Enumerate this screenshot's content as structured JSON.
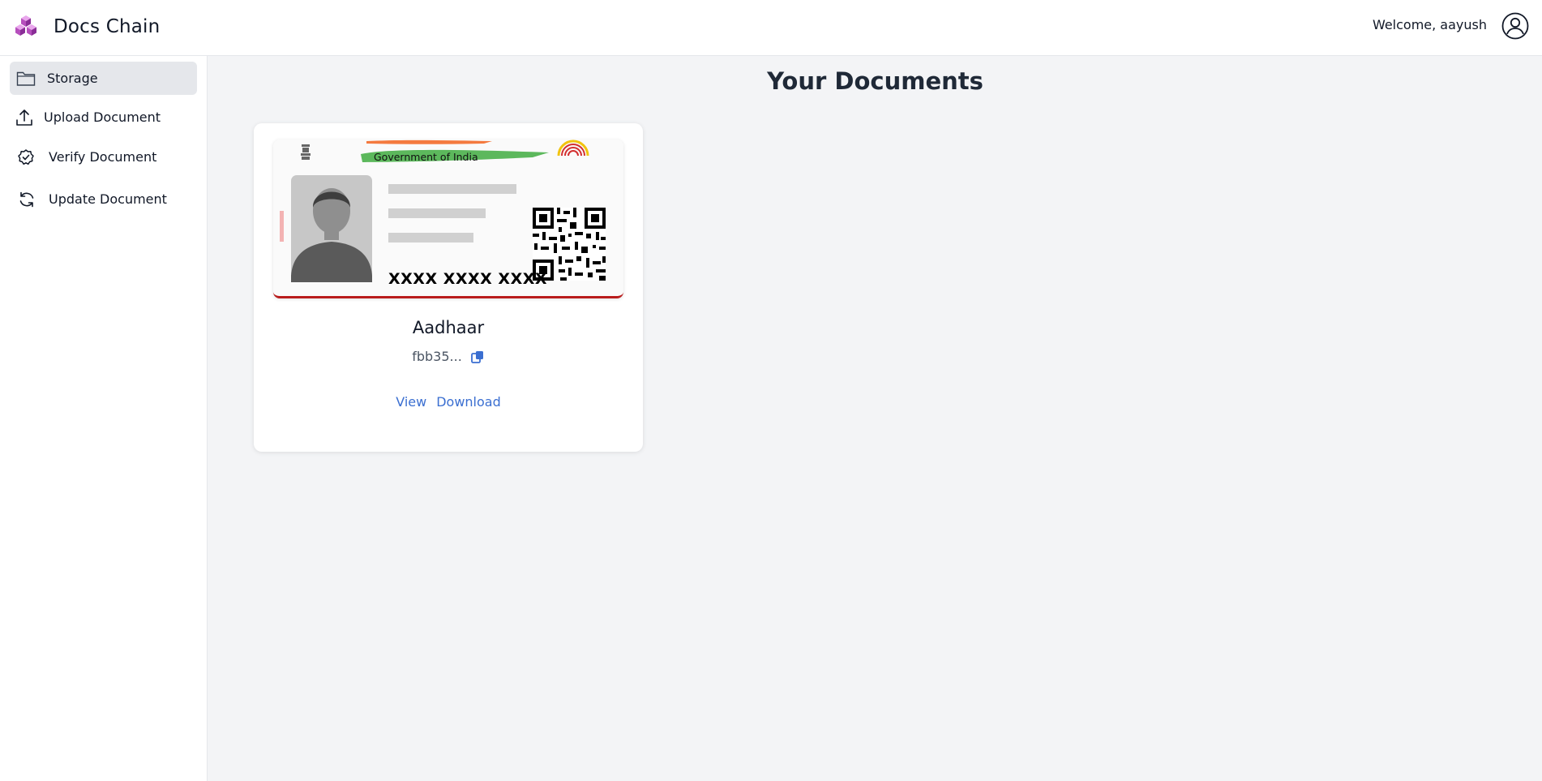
{
  "header": {
    "app_name": "Docs Chain",
    "welcome_text": "Welcome, aayush"
  },
  "sidebar": {
    "items": [
      {
        "label": "Storage",
        "icon": "folder-icon",
        "active": true
      },
      {
        "label": "Upload Document",
        "icon": "upload-icon",
        "active": false
      },
      {
        "label": "Verify Document",
        "icon": "verify-badge-icon",
        "active": false
      },
      {
        "label": "Update Document",
        "icon": "refresh-icon",
        "active": false
      }
    ]
  },
  "main": {
    "title": "Your Documents",
    "documents": [
      {
        "name": "Aadhaar",
        "hash_short": "fbb35...",
        "thumbnail": {
          "header_text": "Government of India",
          "masked_number": "XXXX XXXX XXXX"
        },
        "actions": {
          "view": "View",
          "download": "Download"
        }
      }
    ]
  },
  "colors": {
    "accent_link": "#3b6fd1",
    "active_item_bg": "#e5e7eb",
    "page_bg": "#f3f4f6",
    "logo_purple": "#a855c7"
  }
}
